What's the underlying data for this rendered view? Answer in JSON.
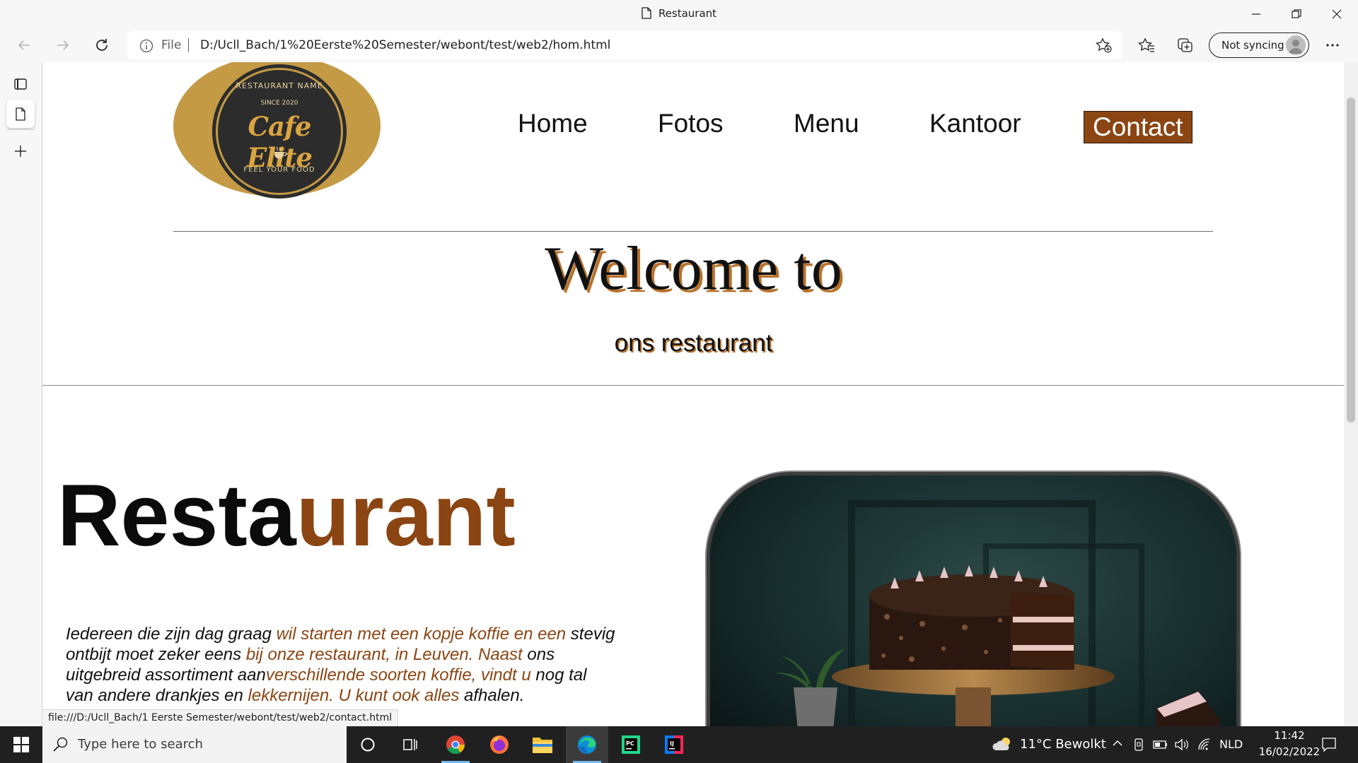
{
  "window": {
    "title": "Restaurant"
  },
  "toolbar": {
    "file_label": "File",
    "url": "D:/Ucll_Bach/1%20Eerste%20Semester/webont/test/web2/hom.html",
    "sync_label": "Not syncing"
  },
  "page": {
    "logo": {
      "top_text": "RESTAURANT NAME",
      "since": "SINCE 2020",
      "name": "Cafe Elite",
      "tagline": "FEEL YOUR FOOD"
    },
    "nav": [
      "Home",
      "Fotos",
      "Menu",
      "Kantoor",
      "Contact"
    ],
    "active_nav": "Contact",
    "welcome": "Welcome to",
    "subtitle": "ons restaurant",
    "restaurant_title_part1": "Resta",
    "restaurant_title_part2": "urant",
    "intro": {
      "t1": "Iedereen die zijn dag graag ",
      "h1": "wil starten met een kopje koffie en een",
      "t2": " stevig ontbijt moet zeker eens ",
      "h2": "bij onze restaurant, in Leuven. Naast",
      "t3": " ons uitgebreid assortiment aan",
      "h3": "verschillende soorten koffie, vindt u",
      "t4": " nog tal van andere drankjes en ",
      "h4": "lekkernijen. U kunt ook alles",
      "t5": " afhalen."
    }
  },
  "status_bar": "file:///D:/Ucll_Bach/1 Eerste Semester/webont/test/web2/contact.html",
  "taskbar": {
    "search_placeholder": "Type here to search",
    "weather": "11°C  Bewolkt",
    "language": "NLD",
    "time": "11:42",
    "date": "16/02/2022"
  },
  "colors": {
    "accent_brown": "#8b4513",
    "logo_gold": "#c49a45",
    "taskbar": "#202020"
  }
}
